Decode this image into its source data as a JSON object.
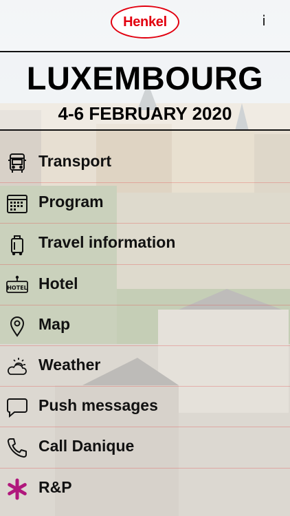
{
  "header": {
    "logo_text": "Henkel",
    "info_label": "i",
    "title": "LUXEMBOURG",
    "dates": "4-6 FEBRUARY 2020"
  },
  "menu": {
    "items": [
      {
        "label": "Transport",
        "icon": "bus-icon"
      },
      {
        "label": "Program",
        "icon": "calendar-icon"
      },
      {
        "label": "Travel information",
        "icon": "suitcase-icon"
      },
      {
        "label": "Hotel",
        "icon": "hotel-icon"
      },
      {
        "label": "Map",
        "icon": "map-pin-icon"
      },
      {
        "label": "Weather",
        "icon": "weather-icon"
      },
      {
        "label": "Push messages",
        "icon": "message-icon"
      },
      {
        "label": "Call Danique",
        "icon": "phone-icon"
      },
      {
        "label": "R&P",
        "icon": "star-icon"
      }
    ]
  },
  "colors": {
    "brand_red": "#e2000f",
    "star_magenta": "#b0177c",
    "text": "#111111"
  }
}
